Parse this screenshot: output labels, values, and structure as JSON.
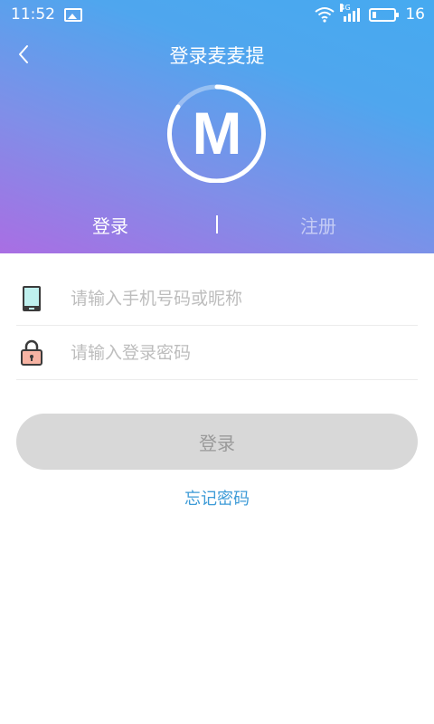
{
  "statusbar": {
    "time": "11:52",
    "signal_tag": "4G",
    "battery": "16"
  },
  "header": {
    "title": "登录麦麦提",
    "logo_letter": "M"
  },
  "tabs": {
    "login": "登录",
    "register": "注册"
  },
  "form": {
    "phone_placeholder": "请输入手机号码或昵称",
    "password_placeholder": "请输入登录密码",
    "phone_value": "",
    "password_value": ""
  },
  "buttons": {
    "login": "登录",
    "forgot": "忘记密码"
  },
  "icons": {
    "back": "chevron-left-icon",
    "phone": "phone-icon",
    "lock": "lock-icon"
  },
  "colors": {
    "gradient_start": "#a96ee3",
    "gradient_end": "#46aaf0",
    "link": "#3d9bd7",
    "button_disabled": "#d8d8d8"
  }
}
